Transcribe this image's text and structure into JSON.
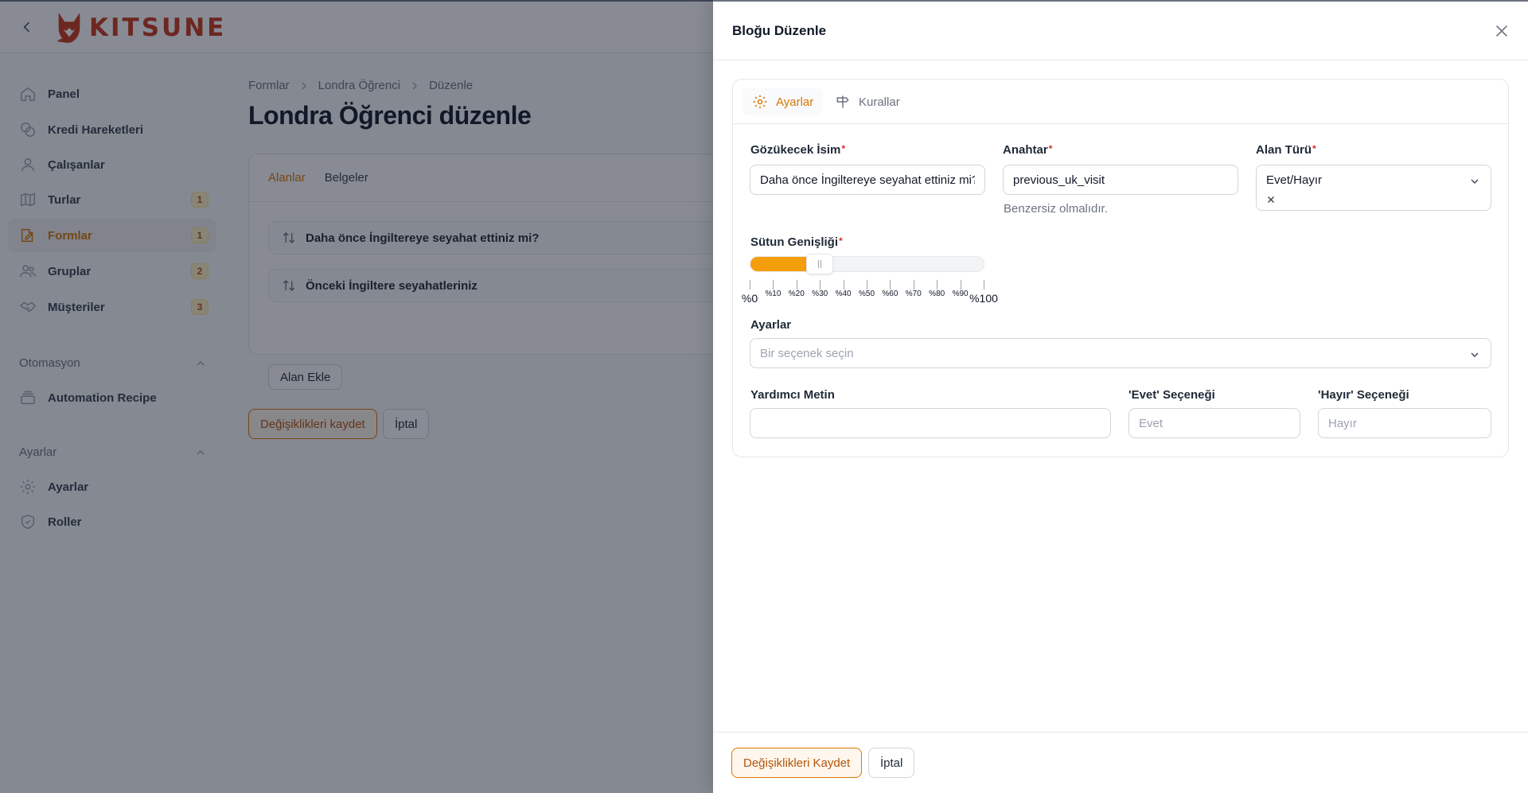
{
  "app": {
    "brand": "KITSUNE",
    "colors": {
      "accent": "#d97706",
      "accent_fill": "#f59e0b",
      "brand": "#c8361b",
      "required": "#dc2626"
    }
  },
  "sidebar": {
    "items": [
      {
        "label": "Panel",
        "icon": "home-icon",
        "badge": ""
      },
      {
        "label": "Kredi Hareketleri",
        "icon": "coins-icon",
        "badge": ""
      },
      {
        "label": "Çalışanlar",
        "icon": "user-icon",
        "badge": ""
      },
      {
        "label": "Turlar",
        "icon": "map-icon",
        "badge": "1"
      },
      {
        "label": "Formlar",
        "icon": "edit-form-icon",
        "badge": "1",
        "active": true
      },
      {
        "label": "Gruplar",
        "icon": "users-icon",
        "badge": "2"
      },
      {
        "label": "Müşteriler",
        "icon": "handshake-icon",
        "badge": "3"
      }
    ],
    "groups": [
      {
        "label": "Otomasyon",
        "items": [
          {
            "label": "Automation Recipe",
            "icon": "stack-icon"
          }
        ]
      },
      {
        "label": "Ayarlar",
        "items": [
          {
            "label": "Ayarlar",
            "icon": "gear-icon"
          },
          {
            "label": "Roller",
            "icon": "shield-icon"
          }
        ]
      }
    ]
  },
  "main": {
    "breadcrumb": [
      "Formlar",
      "Londra Öğrenci",
      "Düzenle"
    ],
    "title": "Londra Öğrenci düzenle",
    "tabs": [
      "Alanlar",
      "Belgeler"
    ],
    "fields": [
      "Daha önce İngiltereye seyahat ettiniz mi?",
      "Önceki İngiltere seyahatleriniz"
    ],
    "add_field_label": "Alan Ekle",
    "save_label": "Değişiklikleri kaydet",
    "cancel_label": "İptal"
  },
  "panel": {
    "title": "Bloğu Düzenle",
    "tabs": [
      {
        "label": "Ayarlar",
        "icon": "gear-icon"
      },
      {
        "label": "Kurallar",
        "icon": "signpost-icon"
      }
    ],
    "form": {
      "display_name": {
        "label": "Gözükecek İsim",
        "value": "Daha önce İngiltereye seyahat ettiniz mi?"
      },
      "key": {
        "label": "Anahtar",
        "value": "previous_uk_visit",
        "hint": "Benzersiz olmalıdır."
      },
      "field_type": {
        "label": "Alan Türü",
        "value": "Evet/Hayır"
      },
      "column_width": {
        "label": "Sütun Genişliği",
        "value": 30,
        "ticks": [
          "%0",
          "%10",
          "%20",
          "%30",
          "%40",
          "%50",
          "%60",
          "%70",
          "%80",
          "%90",
          "%100"
        ]
      },
      "settings": {
        "label": "Ayarlar",
        "placeholder": "Bir seçenek seçin"
      },
      "helper_text": {
        "label": "Yardımcı Metin",
        "value": ""
      },
      "yes_option": {
        "label": "'Evet' Seçeneği",
        "placeholder": "Evet"
      },
      "no_option": {
        "label": "'Hayır' Seçeneği",
        "placeholder": "Hayır"
      }
    },
    "save_label": "Değişiklikleri Kaydet",
    "cancel_label": "İptal"
  }
}
